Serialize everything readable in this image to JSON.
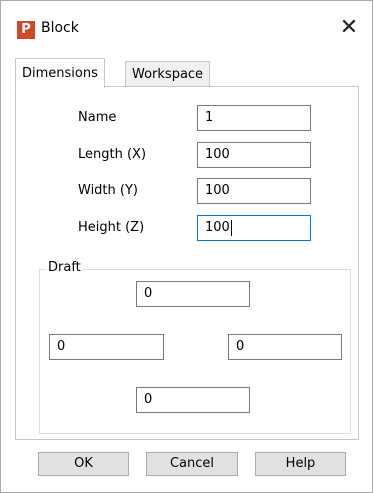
{
  "window": {
    "title": "Block",
    "app_icon_letter": "P",
    "close_glyph": "✕"
  },
  "tabs": [
    {
      "label": "Dimensions"
    },
    {
      "label": "Workspace"
    }
  ],
  "fields": {
    "name": {
      "label": "Name",
      "value": "1"
    },
    "length": {
      "label": "Length (X)",
      "value": "100"
    },
    "width": {
      "label": "Width (Y)",
      "value": "100"
    },
    "height": {
      "label": "Height (Z)",
      "value": "100"
    }
  },
  "draft": {
    "label": "Draft",
    "top": "0",
    "left": "0",
    "right": "0",
    "bottom": "0"
  },
  "buttons": {
    "ok": "OK",
    "cancel": "Cancel",
    "help": "Help"
  }
}
